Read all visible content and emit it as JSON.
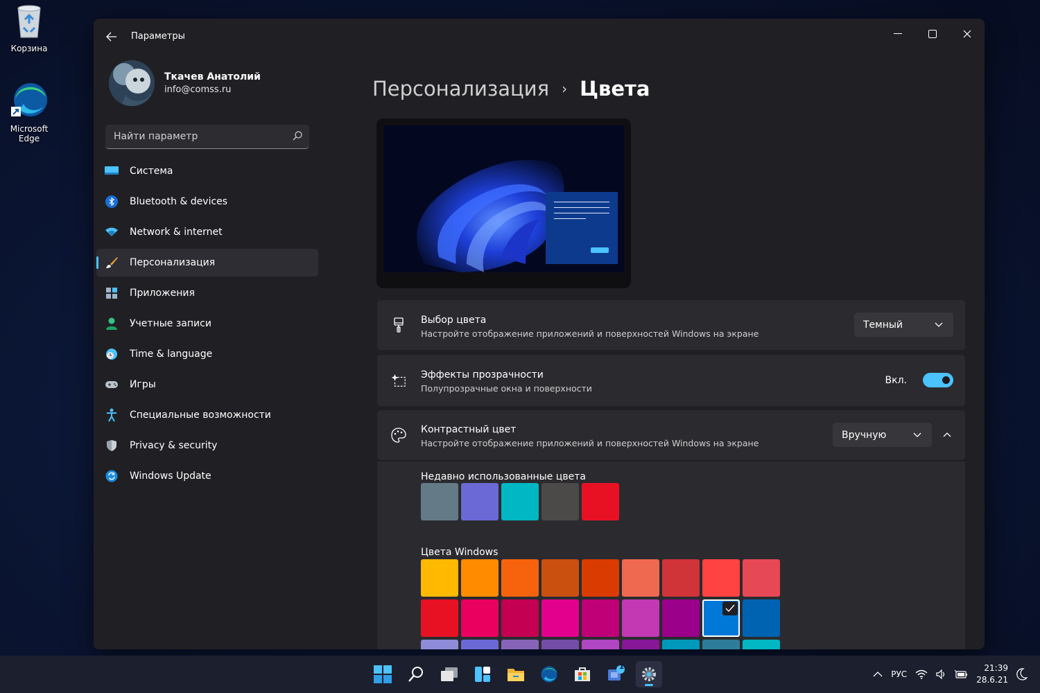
{
  "desktop": {
    "icons": [
      {
        "label": "Корзина",
        "icon": "recycle-bin-icon"
      },
      {
        "label": "Microsoft Edge",
        "icon": "edge-icon"
      }
    ]
  },
  "window": {
    "title": "Параметры",
    "controls": {
      "minimize": "minimize-icon",
      "maximize": "maximize-icon",
      "close": "close-icon"
    }
  },
  "profile": {
    "name": "Ткачев Анатолий",
    "email": "info@comss.ru"
  },
  "search": {
    "placeholder": "Найти параметр"
  },
  "nav": {
    "items": [
      {
        "label": "Система",
        "icon": "system-icon"
      },
      {
        "label": "Bluetooth & devices",
        "icon": "bluetooth-icon"
      },
      {
        "label": "Network & internet",
        "icon": "wifi-icon"
      },
      {
        "label": "Персонализация",
        "icon": "brush-icon",
        "active": true
      },
      {
        "label": "Приложения",
        "icon": "apps-icon"
      },
      {
        "label": "Учетные записи",
        "icon": "accounts-icon"
      },
      {
        "label": "Time & language",
        "icon": "clock-globe-icon"
      },
      {
        "label": "Игры",
        "icon": "gamepad-icon"
      },
      {
        "label": "Специальные возможности",
        "icon": "accessibility-icon"
      },
      {
        "label": "Privacy & security",
        "icon": "shield-icon"
      },
      {
        "label": "Windows Update",
        "icon": "update-icon"
      }
    ]
  },
  "breadcrumb": {
    "parent": "Персонализация",
    "separator": "›",
    "current": "Цвета"
  },
  "cards": {
    "color_mode": {
      "title": "Выбор цвета",
      "subtitle": "Настройте отображение приложений и поверхностей Windows на экране",
      "value": "Темный"
    },
    "transparency": {
      "title": "Эффекты прозрачности",
      "subtitle": "Полупрозрачные окна и поверхности",
      "state_label": "Вкл.",
      "on": true
    },
    "accent": {
      "title": "Контрастный цвет",
      "subtitle": "Настройте отображение приложений и поверхностей Windows на экране",
      "value": "Вручную"
    }
  },
  "recent_colors": {
    "label": "Недавно использованные цвета",
    "colors": [
      "#647a87",
      "#6b69d6",
      "#00b7c3",
      "#4c4a48",
      "#e81123"
    ]
  },
  "windows_colors": {
    "label": "Цвета Windows",
    "rows": [
      [
        "#ffb900",
        "#ff8c00",
        "#f7630c",
        "#ca5010",
        "#da3b01",
        "#ef6950",
        "#d13438",
        "#ff4343",
        "#e74856"
      ],
      [
        "#e81123",
        "#ea005e",
        "#c30052",
        "#e3008c",
        "#bf0077",
        "#c239b3",
        "#9a0089",
        "#0078d7",
        "#0063b1"
      ],
      [
        "#8e8cd8",
        "#6b69d6",
        "#8764b8",
        "#744da9",
        "#b146c2",
        "#881798",
        "#0099bc",
        "#2d7d9a",
        "#00b7c3"
      ]
    ],
    "selected": "#0078d7"
  },
  "taskbar": {
    "apps": [
      "start-icon",
      "search-icon",
      "task-view-icon",
      "widgets-icon",
      "file-explorer-icon",
      "edge-icon",
      "store-icon",
      "chat-icon",
      "settings-icon"
    ],
    "chat_badge": "1",
    "tray": {
      "language": "РУС",
      "time": "21:39",
      "date": "28.6.21"
    }
  },
  "colors": {
    "accent": "#4cc2ff",
    "window_bg": "#202024",
    "card_bg": "#2b2b2f"
  }
}
